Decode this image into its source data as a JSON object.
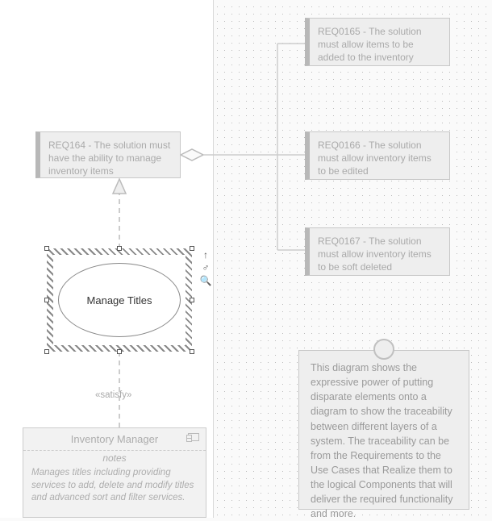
{
  "requirements": {
    "main": "REQ164 - The solution must have the ability to manage inventory items",
    "children": [
      "REQ0165 - The solution must allow items to be added to the inventory",
      "REQ0166 - The solution must allow inventory items to be edited",
      "REQ0167 - The solution must allow inventory items to be soft deleted"
    ]
  },
  "usecase": {
    "name": "Manage Titles"
  },
  "relationship": {
    "stereotype": "«satisfy»"
  },
  "component": {
    "name": "Inventory Manager",
    "notes_label": "notes",
    "notes": "Manages titles including providing services to add, delete and modify titles and advanced sort and filter services."
  },
  "note": "This diagram shows the expressive power of putting disparate elements onto a diagram to show the traceability between different layers of a system. The traceability can be from the Requirements to the Use Cases that Realize them to the logical Components that will deliver the required functionality and more.",
  "tools": {
    "up": "↑",
    "link": "♂",
    "zoom": "🔍"
  }
}
